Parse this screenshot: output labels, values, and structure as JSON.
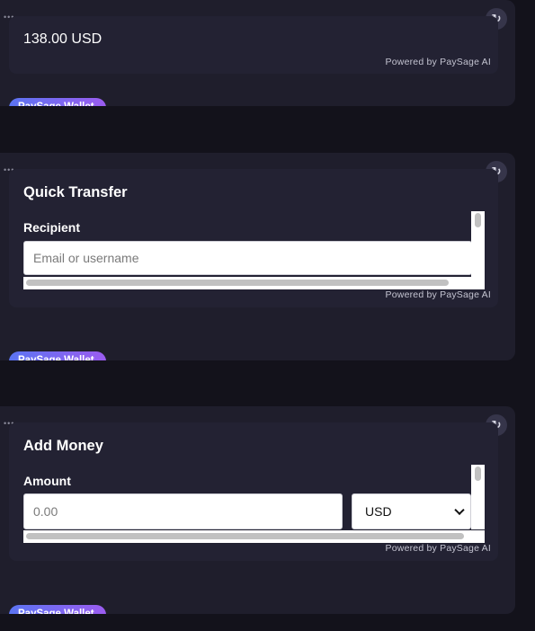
{
  "widgets": [
    {
      "balance": "138.00 USD",
      "powered_by": "Powered by PaySage AI",
      "brand": "PaySage Wallet",
      "menu_dots": "•••",
      "refresh_glyph": "↻"
    },
    {
      "title": "Quick Transfer",
      "field_label": "Recipient",
      "input_placeholder": "Email or username",
      "powered_by": "Powered by PaySage AI",
      "brand": "PaySage Wallet",
      "menu_dots": "•••",
      "refresh_glyph": "↻"
    },
    {
      "title": "Add Money",
      "field_label": "Amount",
      "input_placeholder": "0.00",
      "currency_selected": "USD",
      "powered_by": "Powered by PaySage AI",
      "brand": "PaySage Wallet",
      "menu_dots": "•••",
      "refresh_glyph": "↻"
    }
  ],
  "icons": {
    "menu": "more-horizontal-icon",
    "refresh": "refresh-icon",
    "chevron": "chevron-down-icon"
  }
}
